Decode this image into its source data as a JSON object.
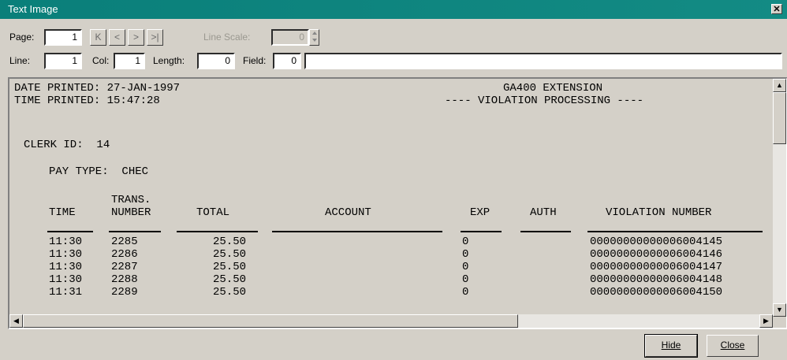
{
  "window": {
    "title": "Text Image"
  },
  "toolbar": {
    "page_label": "Page:",
    "page_value": "1",
    "first_label": "K",
    "prev_label": "<",
    "next_label": ">",
    "last_label": ">|",
    "line_scale_label": "Line Scale:",
    "line_scale_value": "0",
    "line_label": "Line:",
    "line_value": "1",
    "col_label": "Col:",
    "col_value": "1",
    "length_label": "Length:",
    "length_value": "0",
    "field_label": "Field:",
    "field_value": "0",
    "field_text": ""
  },
  "report": {
    "date_printed": "DATE PRINTED: 27-JAN-1997",
    "time_printed": "TIME PRINTED: 15:47:28",
    "heading1": "GA400 EXTENSION",
    "heading2": "---- VIOLATION PROCESSING ----",
    "clerk_id": "CLERK ID:  14",
    "pay_type": "PAY TYPE:  CHEC",
    "columns": {
      "time": "TIME",
      "trans1": "TRANS.",
      "trans2": "NUMBER",
      "total": "TOTAL",
      "account": "ACCOUNT",
      "exp": "EXP",
      "auth": "AUTH",
      "violation": "VIOLATION NUMBER"
    },
    "rows": [
      {
        "time": "11:30",
        "trans": "2285",
        "total": "25.50",
        "exp": "0",
        "violation": "00000000000006004145"
      },
      {
        "time": "11:30",
        "trans": "2286",
        "total": "25.50",
        "exp": "0",
        "violation": "00000000000006004146"
      },
      {
        "time": "11:30",
        "trans": "2287",
        "total": "25.50",
        "exp": "0",
        "violation": "00000000000006004147"
      },
      {
        "time": "11:30",
        "trans": "2288",
        "total": "25.50",
        "exp": "0",
        "violation": "00000000000006004148"
      },
      {
        "time": "11:31",
        "trans": "2289",
        "total": "25.50",
        "exp": "0",
        "violation": "00000000000006004150"
      }
    ]
  },
  "buttons": {
    "hide": "Hide",
    "close": "Close"
  }
}
